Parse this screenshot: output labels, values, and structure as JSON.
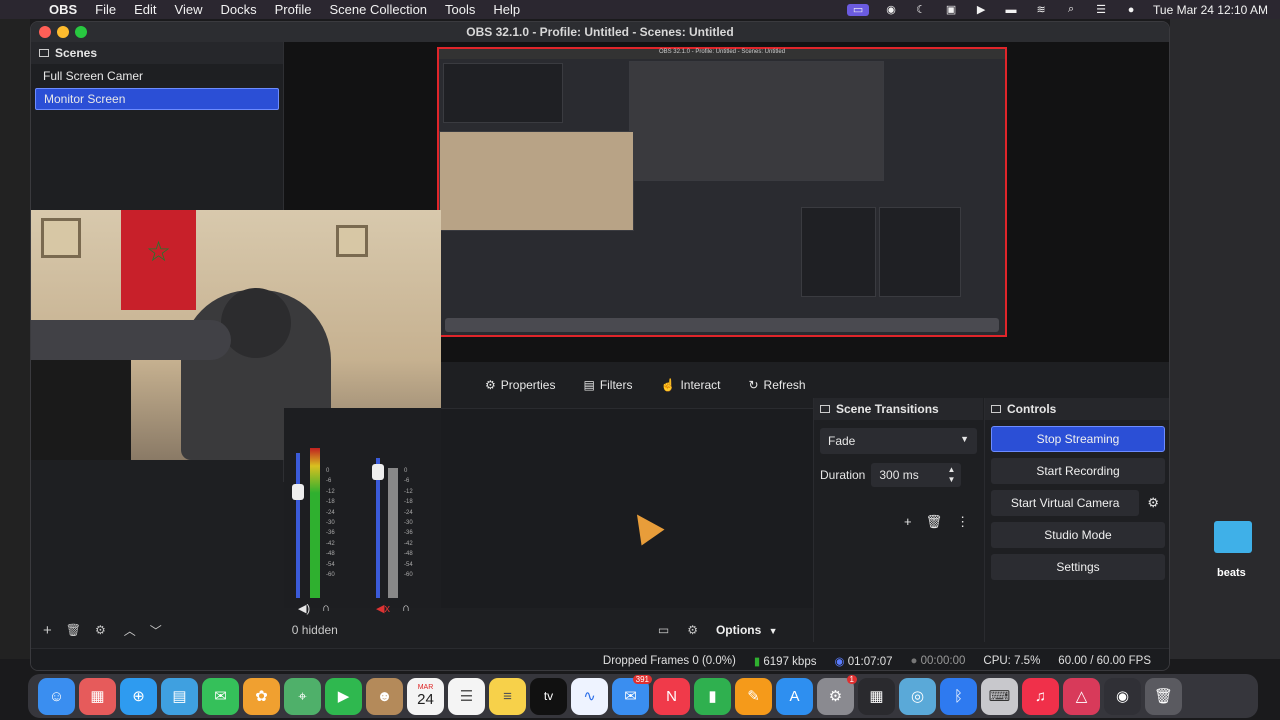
{
  "menubar": {
    "app": "OBS",
    "items": [
      "File",
      "Edit",
      "View",
      "Docks",
      "Profile",
      "Scene Collection",
      "Tools",
      "Help"
    ],
    "clock": "Tue Mar 24  12:10 AM"
  },
  "window": {
    "title": "OBS 32.1.0 - Profile: Untitled - Scenes: Untitled"
  },
  "scenes": {
    "header": "Scenes",
    "items": [
      {
        "label": "Full Screen Camer",
        "selected": false
      },
      {
        "label": "Monitor Screen",
        "selected": true
      }
    ]
  },
  "propbar": {
    "properties": "Properties",
    "filters": "Filters",
    "interact": "Interact",
    "refresh": "Refresh"
  },
  "transitions": {
    "header": "Scene Transitions",
    "selected": "Fade",
    "duration_label": "Duration",
    "duration_value": "300 ms"
  },
  "controls": {
    "header": "Controls",
    "stop_streaming": "Stop Streaming",
    "start_recording": "Start Recording",
    "start_virtual_camera": "Start Virtual Camera",
    "studio_mode": "Studio Mode",
    "settings": "Settings"
  },
  "lowbar": {
    "hidden": "0 hidden",
    "options": "Options"
  },
  "mixer_scale": [
    "0",
    "-6",
    "-12",
    "-18",
    "-24",
    "-30",
    "-36",
    "-42",
    "-48",
    "-54",
    "-60"
  ],
  "status": {
    "dropped": "Dropped Frames 0 (0.0%)",
    "bitrate": "6197 kbps",
    "stream_time": "01:07:07",
    "rec_time": "00:00:00",
    "cpu": "CPU: 7.5%",
    "fps": "60.00 / 60.00 FPS"
  },
  "desktop": {
    "folder_label": "beats"
  },
  "dock": {
    "calendar_month": "MAR",
    "calendar_day": "24",
    "mail_badge": "391",
    "settings_badge": "1",
    "tv_label": "tv"
  },
  "preview_thumb": {
    "title": "OBS 32.1.0 - Profile: Untitled - Scenes: Untitled"
  },
  "colors": {
    "accent": "#2b4fd6",
    "record_red": "#e0252a"
  }
}
